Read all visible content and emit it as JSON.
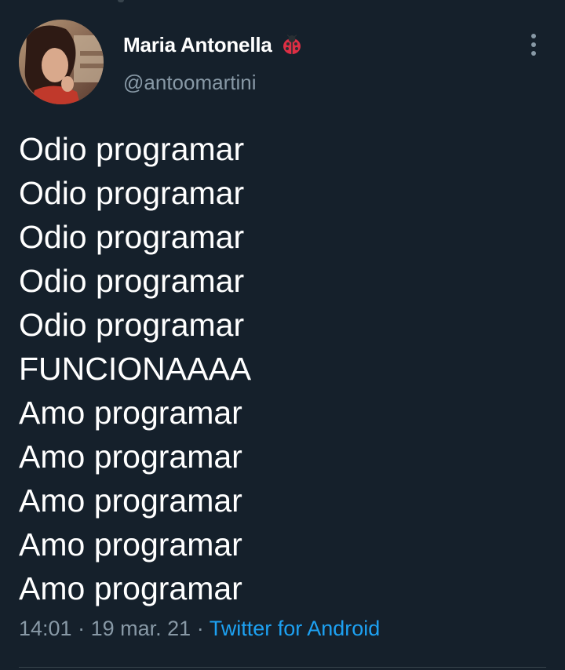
{
  "tweet": {
    "author": {
      "display_name": "Maria Antonella",
      "handle": "@antoomartini",
      "name_emoji_icon": "ladybug-icon"
    },
    "menu_icon": "more-vertical-icon",
    "text_lines": [
      "Odio programar",
      "Odio programar",
      "Odio programar",
      "Odio programar",
      "Odio programar",
      "FUNCIONAAAA",
      "Amo programar",
      "Amo programar",
      "Amo programar",
      "Amo programar",
      "Amo programar"
    ],
    "time": "14:01",
    "separator": "·",
    "date": "19 mar. 21",
    "source": "Twitter for Android"
  },
  "colors": {
    "background": "#15202b",
    "primary_text": "#ffffff",
    "secondary_text": "#8899a6",
    "link": "#1da1f2",
    "divider": "#38444d"
  }
}
